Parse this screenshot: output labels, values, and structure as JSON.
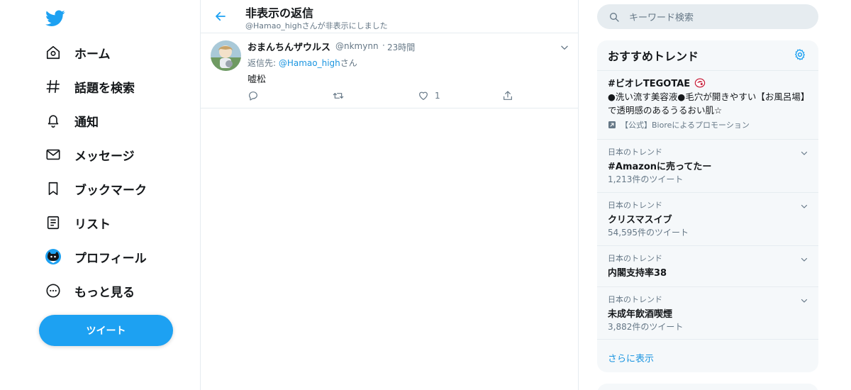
{
  "nav": {
    "items": [
      {
        "label": "ホーム",
        "icon": "home-icon"
      },
      {
        "label": "話題を検索",
        "icon": "hashtag-icon"
      },
      {
        "label": "通知",
        "icon": "bell-icon"
      },
      {
        "label": "メッセージ",
        "icon": "envelope-icon"
      },
      {
        "label": "ブックマーク",
        "icon": "bookmark-icon"
      },
      {
        "label": "リスト",
        "icon": "list-icon"
      },
      {
        "label": "プロフィール",
        "icon": "profile-avatar-icon"
      },
      {
        "label": "もっと見る",
        "icon": "more-circle-icon"
      }
    ],
    "tweet_button": "ツイート"
  },
  "header": {
    "title": "非表示の返信",
    "subtitle": "@Hamao_highさんが非表示にしました"
  },
  "tweet": {
    "name": "おまんちんザウルス",
    "handle": "@nkmynn",
    "separator": "·",
    "time": "23時間",
    "reply_prefix": "返信先: ",
    "reply_mention": "@Hamao_high",
    "reply_suffix": "さん",
    "text": "嘘松",
    "like_count": "1"
  },
  "search": {
    "placeholder": "キーワード検索"
  },
  "trends": {
    "title": "おすすめトレンド",
    "promoted": {
      "name": "#ビオレTEGOTAE",
      "description": "●洗い流す美容液●毛穴が開きやすい【お風呂場】で透明感のあるうるおい肌☆",
      "promoter": "【公式】Bioreによるプロモーション"
    },
    "items": [
      {
        "category": "日本のトレンド",
        "name": "#Amazonに売ってたー",
        "count": "1,213件のツイート"
      },
      {
        "category": "日本のトレンド",
        "name": "クリスマスイブ",
        "count": "54,595件のツイート"
      },
      {
        "category": "日本のトレンド",
        "name": "内閣支持率38",
        "count": ""
      },
      {
        "category": "日本のトレンド",
        "name": "未成年飲酒喫煙",
        "count": "3,882件のツイート"
      }
    ],
    "show_more": "さらに表示"
  },
  "colors": {
    "accent": "#1da1f2",
    "link": "#1b95e0",
    "muted": "#657786",
    "border": "#e6ecf0",
    "panel": "#f5f8fa"
  }
}
